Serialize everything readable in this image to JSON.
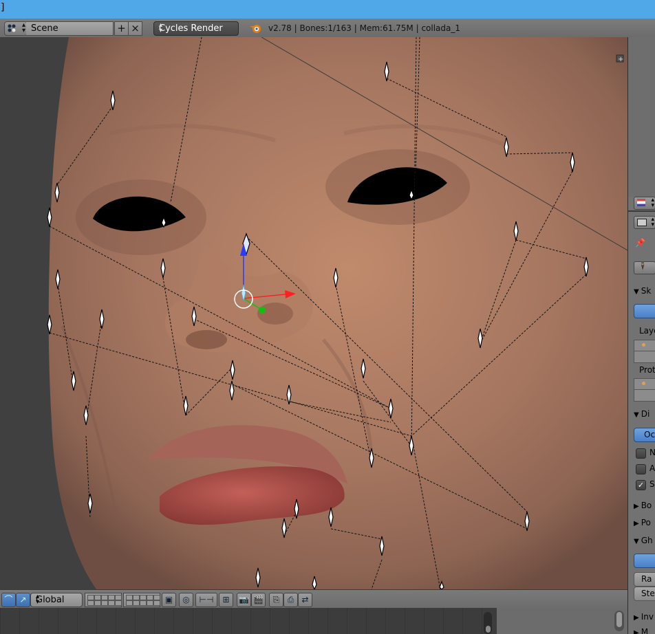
{
  "window": {
    "title_fragment": "]"
  },
  "info_header": {
    "editor_type_icon": "editor-type-icon",
    "scene_name": "Scene",
    "scene_add_icon": "plus-icon",
    "scene_remove_icon": "close-x-icon",
    "render_engine": "Cycles Render",
    "blender_logo_icon": "blender-logo-icon",
    "stats": "v2.78 | Bones:1/163  | Mem:61.75M | collada_1"
  },
  "viewport": {
    "content": "textured head mesh with armature bones in wire display",
    "manipulator_axes": [
      "z-axis-blue",
      "x-axis-red",
      "y-axis-green"
    ]
  },
  "properties_panel": {
    "sections": [
      {
        "label": "Sk",
        "expanded": true
      },
      {
        "label": "Layers",
        "text": "Laye"
      },
      {
        "label": "Protected Layers",
        "text": "Prote"
      },
      {
        "label": "Di",
        "expanded": true
      },
      {
        "label": "Oc",
        "button": true
      },
      {
        "label": "N",
        "checked": false
      },
      {
        "label": "A",
        "checked": false
      },
      {
        "label": "S",
        "checked": true
      },
      {
        "label": "Bo",
        "expanded": false
      },
      {
        "label": "Po",
        "expanded": false
      },
      {
        "label": "Gh",
        "expanded": true
      },
      {
        "label": "Ra",
        "button": true
      },
      {
        "label": "Ste",
        "button": true
      },
      {
        "label": "Inv",
        "expanded": false
      },
      {
        "label": "M",
        "expanded": false
      }
    ]
  },
  "viewport_header": {
    "pivot_icon": "curve-icon",
    "manipulator_icon": "manipulator-icon",
    "orientation": "Global",
    "layer_icons": [
      "layers-grid-a",
      "layers-grid-b"
    ],
    "lock_icon": "lock-camera-icon",
    "proportional_icon": "proportional-edit-icon",
    "snap_icon": "snap-icon",
    "render_icons": [
      "camera-render-icon",
      "clapper-render-icon"
    ],
    "copy_paste_icons": [
      "copy-pose-icon",
      "paste-pose-icon",
      "paste-flipped-icon"
    ]
  },
  "colors": {
    "titlebar": "#50a8e8",
    "accent_blue": "#4a7fc6",
    "background": "#393939"
  }
}
